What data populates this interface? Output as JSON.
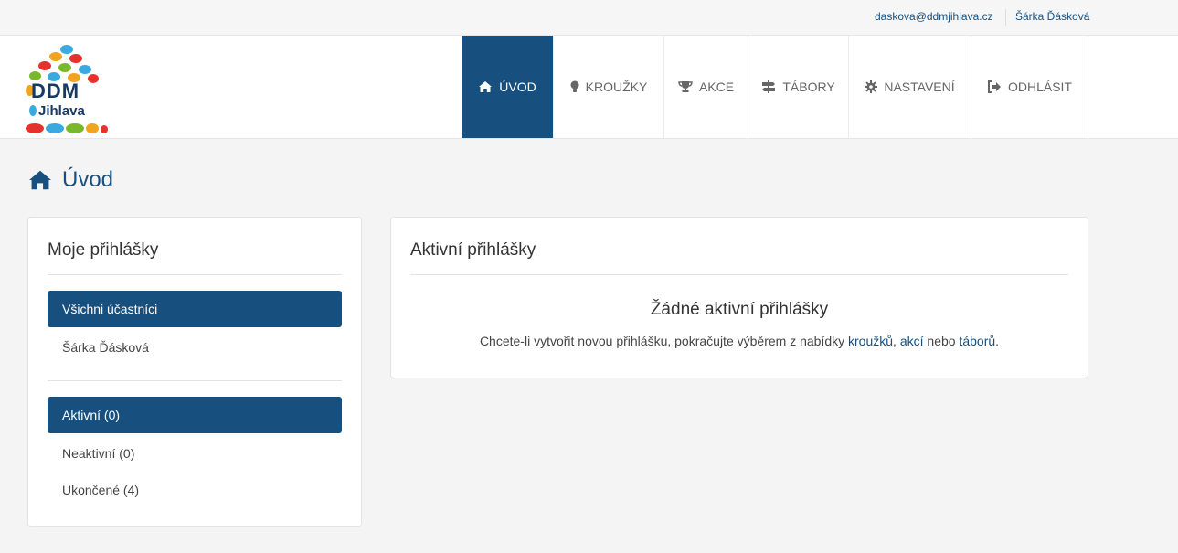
{
  "topbar": {
    "email": "daskova@ddmjihlava.cz",
    "user": "Šárka Ďásková"
  },
  "logo": {
    "line1": "DDM",
    "line2": "Jihlava"
  },
  "nav": [
    {
      "label": "ÚVOD",
      "icon": "home-icon",
      "active": true
    },
    {
      "label": "KROUŽKY",
      "icon": "lightbulb-icon",
      "active": false
    },
    {
      "label": "AKCE",
      "icon": "trophy-icon",
      "active": false
    },
    {
      "label": "TÁBORY",
      "icon": "signpost-icon",
      "active": false
    },
    {
      "label": "NASTAVENÍ",
      "icon": "gear-icon",
      "active": false
    },
    {
      "label": "ODHLÁSIT",
      "icon": "logout-icon",
      "active": false
    }
  ],
  "page": {
    "title": "Úvod"
  },
  "sidebar": {
    "title": "Moje přihlášky",
    "participants": [
      "Všichni účastníci",
      "Šárka Ďásková"
    ],
    "filters": [
      "Aktivní (0)",
      "Neaktivní (0)",
      "Ukončené (4)"
    ]
  },
  "main": {
    "title": "Aktivní přihlášky",
    "empty_title": "Žádné aktivní přihlášky",
    "empty_text_prefix": "Chcete-li vytvořit novou přihlášku, pokračujte výběrem z nabídky",
    "link_krouzky": "kroužků",
    "comma": ",",
    "link_akce": "akcí",
    "nebo": "nebo",
    "link_tabory": "táborů",
    "period": "."
  },
  "colors": {
    "primary": "#17507f",
    "background": "#f4f4f4"
  }
}
